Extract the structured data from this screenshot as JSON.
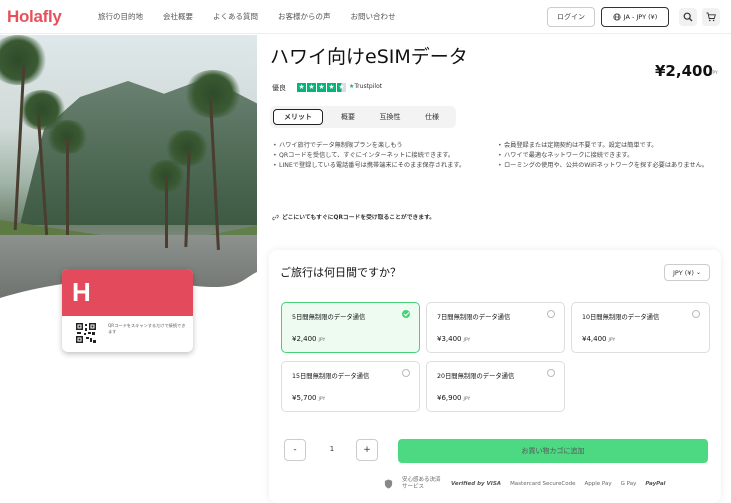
{
  "header": {
    "logo": "Holafly",
    "nav": [
      "旅行の目的地",
      "会社概要",
      "よくある質問",
      "お客様からの声",
      "お問い合わせ"
    ],
    "login_label": "ログイン",
    "lang_label": "JA - JPY (¥)"
  },
  "product": {
    "title": "ハワイ向けeSIMデータ",
    "price": "¥2,400",
    "price_unit": "JPY",
    "rating_label": "優良",
    "trustpilot": "Trustpilot",
    "stars": 4.5
  },
  "card": {
    "brand_mark": "H",
    "qr_text": "QRコードをスキャンするだけで接続できます"
  },
  "tabs": [
    {
      "label": "メリット",
      "active": true
    },
    {
      "label": "概要",
      "active": false
    },
    {
      "label": "互換性",
      "active": false
    },
    {
      "label": "仕様",
      "active": false
    }
  ],
  "features_left": [
    "ハワイ旅行でデータ無制限プランを楽しもう",
    "QRコードを受信して、すぐにインターネットに接続できます。",
    "LINEで登録している電話番号は携帯端末にそのまま保存されます。"
  ],
  "features_right": [
    "会員登録または定期契約は不要です。設定は簡単です。",
    "ハワイで最適なネットワークに接続できます。",
    "ローミングの使用や、公共のWiFiネットワークを探す必要はありません。"
  ],
  "note": "どこにいてもすぐにQRコードを受け取ることができます。",
  "booking": {
    "title": "ご旅行は何日間ですか？",
    "currency": "JPY (¥)",
    "plans": [
      {
        "name": "5日間無制限のデータ通信",
        "price": "¥2,400",
        "unit": "JPY",
        "selected": true
      },
      {
        "name": "7日間無制限のデータ通信",
        "price": "¥3,400",
        "unit": "JPY",
        "selected": false
      },
      {
        "name": "10日間無制限のデータ通信",
        "price": "¥4,400",
        "unit": "JPY",
        "selected": false
      },
      {
        "name": "15日間無制限のデータ通信",
        "price": "¥5,700",
        "unit": "JPY",
        "selected": false
      },
      {
        "name": "20日間無制限のデータ通信",
        "price": "¥6,900",
        "unit": "JPY",
        "selected": false
      }
    ],
    "quantity": "1",
    "minus": "-",
    "plus": "+",
    "cart_label": "お買い物カゴに追加"
  },
  "payment": {
    "secure_label": "安心感ある決済サービス",
    "methods": [
      "Verified by VISA",
      "Mastercard SecureCode",
      "Apple Pay",
      "G Pay",
      "PayPal"
    ]
  },
  "colors": {
    "brand": "#e8505b",
    "accent_green": "#45d276",
    "trustpilot_green": "#00b67a"
  }
}
